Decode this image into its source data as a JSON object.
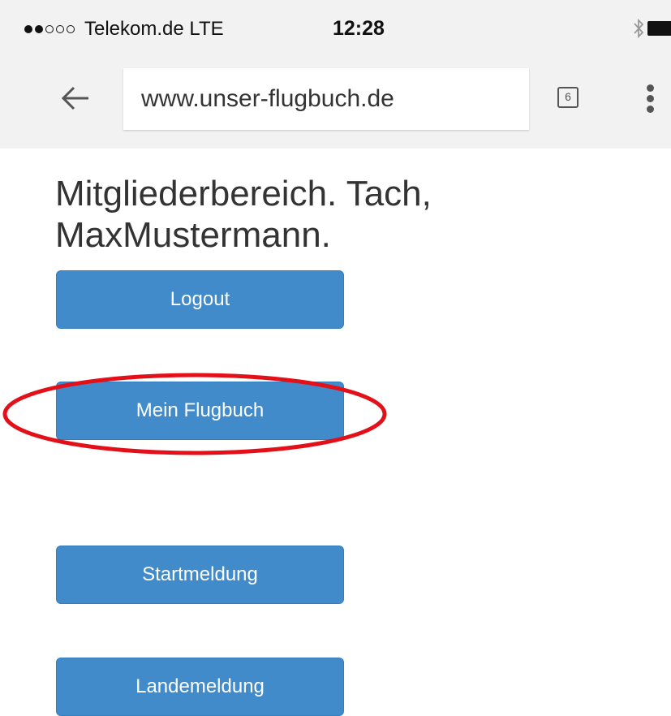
{
  "status_bar": {
    "signal_strength": "2 of 5",
    "carrier": "Telekom.de  LTE",
    "time": "12:28",
    "icons": [
      "bluetooth-icon",
      "battery-icon"
    ]
  },
  "browser": {
    "url": "www.unser-flugbuch.de",
    "tab_count": "6",
    "icons": [
      "back-arrow-icon",
      "tabs-icon",
      "overflow-menu-icon"
    ]
  },
  "page": {
    "heading": "Mitgliederbereich. Tach, MaxMustermann.",
    "buttons": {
      "logout": "Logout",
      "mein_flugbuch": "Mein Flugbuch",
      "startmeldung": "Startmeldung",
      "landemeldung": "Landemeldung"
    },
    "colors": {
      "button_blue": "#428bca",
      "annotation_red": "#e3101a"
    }
  }
}
